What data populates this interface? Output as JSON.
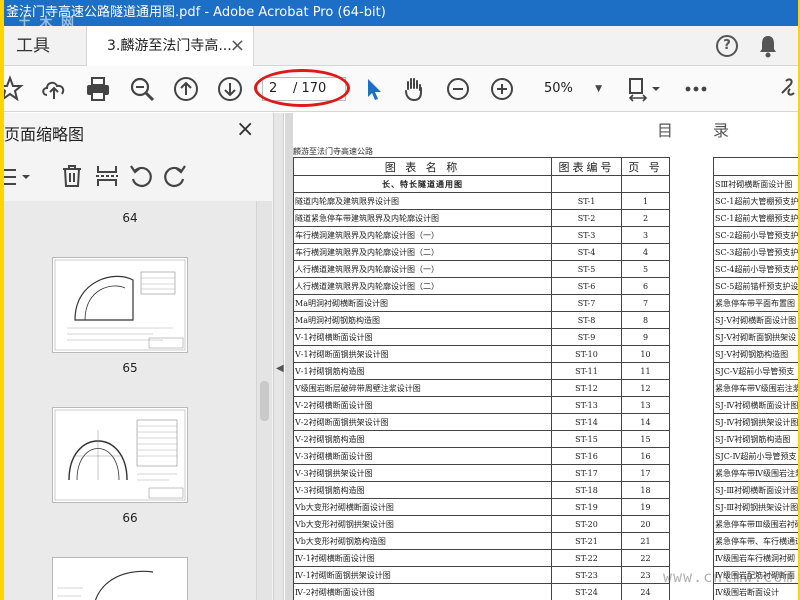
{
  "window": {
    "title": "釜法门寺高速公路隧道通用图.pdf - Adobe Acrobat Pro (64-bit)",
    "watermark": "土 木 网"
  },
  "tabs": {
    "tools_label": "工具",
    "doc_label": "3.麟游至法门寺高...",
    "close_glyph": "×"
  },
  "header_icons": {
    "help": "help-icon",
    "help_glyph": "?",
    "notifications": "bell-icon"
  },
  "toolbar": {
    "icons": [
      "bookmark-star-icon",
      "cloud-upload-icon",
      "print-icon",
      "zoom-search-icon",
      "page-up-icon",
      "page-down-icon",
      "select-cursor-icon",
      "hand-tool-icon",
      "zoom-out-icon",
      "zoom-in-icon",
      "fit-page-icon",
      "more-icon",
      "link-icon"
    ],
    "page_current": "2",
    "page_total": "/ 170",
    "zoom": "50%",
    "highlight_color": "#e01818"
  },
  "sidebar": {
    "title": "页面缩略图",
    "close_glyph": "×",
    "tools": [
      "options-menu-icon",
      "delete-icon",
      "insert-page-icon",
      "undo-icon",
      "redo-icon"
    ],
    "pages": [
      "64",
      "65",
      "66"
    ]
  },
  "document": {
    "heading": "目",
    "heading2": "录",
    "subtitle": "麟游至法门寺高速公路",
    "columns": {
      "name": "图 表 名 称",
      "code": "图表编号",
      "page": "页 号"
    },
    "section": "长、特长隧道通用图",
    "rows": [
      {
        "name": "隧道内轮廓及建筑限界设计图",
        "code": "ST-1",
        "page": "1"
      },
      {
        "name": "隧道紧急停车带建筑限界及内轮廓设计图",
        "code": "ST-2",
        "page": "2"
      },
      {
        "name": "车行横洞建筑限界及内轮廓设计图（一）",
        "code": "ST-3",
        "page": "3"
      },
      {
        "name": "车行横洞建筑限界及内轮廓设计图（二）",
        "code": "ST-4",
        "page": "4"
      },
      {
        "name": "人行横道建筑限界及内轮廓设计图（一）",
        "code": "ST-5",
        "page": "5"
      },
      {
        "name": "人行横道建筑限界及内轮廓设计图（二）",
        "code": "ST-6",
        "page": "6"
      },
      {
        "name": "Ma明洞衬砌横断面设计图",
        "code": "ST-7",
        "page": "7"
      },
      {
        "name": "Ma明洞衬砌钢筋构造图",
        "code": "ST-8",
        "page": "8"
      },
      {
        "name": "Ⅴ-1衬砌横断面设计图",
        "code": "ST-9",
        "page": "9"
      },
      {
        "name": "Ⅴ-1衬砌断面钢拱架设计图",
        "code": "ST-10",
        "page": "10"
      },
      {
        "name": "Ⅴ-1衬砌钢筋构造图",
        "code": "ST-11",
        "page": "11"
      },
      {
        "name": "Ⅴ级围岩断层破碎带周壁注浆设计图",
        "code": "ST-12",
        "page": "12"
      },
      {
        "name": "Ⅴ-2衬砌横断面设计图",
        "code": "ST-13",
        "page": "13"
      },
      {
        "name": "Ⅴ-2衬砌断面钢拱架设计图",
        "code": "ST-14",
        "page": "14"
      },
      {
        "name": "Ⅴ-2衬砌钢筋构造图",
        "code": "ST-15",
        "page": "15"
      },
      {
        "name": "Ⅴ-3衬砌横断面设计图",
        "code": "ST-16",
        "page": "16"
      },
      {
        "name": "Ⅴ-3衬砌钢拱架设计图",
        "code": "ST-17",
        "page": "17"
      },
      {
        "name": "Ⅴ-3衬砌钢筋构造图",
        "code": "ST-18",
        "page": "18"
      },
      {
        "name": "Ⅴb大变形衬砌横断面设计图",
        "code": "ST-19",
        "page": "19"
      },
      {
        "name": "Ⅴb大变形衬砌钢拱架设计图",
        "code": "ST-20",
        "page": "20"
      },
      {
        "name": "Ⅴb大变形衬砌钢筋构造图",
        "code": "ST-21",
        "page": "21"
      },
      {
        "name": "Ⅳ-1衬砌横断面设计图",
        "code": "ST-22",
        "page": "22"
      },
      {
        "name": "Ⅳ-1衬砌断面钢拱架设计图",
        "code": "ST-23",
        "page": "23"
      },
      {
        "name": "Ⅳ-2衬砌横断面设计图",
        "code": "ST-24",
        "page": "24"
      }
    ],
    "right_rows": [
      "SⅢ衬砌横断面设计图",
      "SC-1超前大管棚预支护",
      "SC-1超前大管棚预支护",
      "SC-2超前小导管预支护",
      "SC-3超前小导管预支护",
      "SC-4超前小导管预支护",
      "SC-5超前锚杆预支护设",
      "紧急停车带平面布置图",
      "SJ-Ⅴ衬砌横断面设计图",
      "SJ-Ⅴ衬砌断面钢拱架设",
      "SJ-Ⅴ衬砌钢筋构造图",
      "SJC-Ⅴ超前小导管预支",
      "紧急停车带Ⅴ级围岩注浆",
      "SJ-Ⅳ衬砌横断面设计图",
      "SJ-Ⅳ衬砌钢拱架设计图",
      "SJ-Ⅳ衬砌钢筋构造图",
      "SJC-Ⅳ超前小导管预支",
      "紧急停车带Ⅳ级围岩注浆",
      "SJ-Ⅲ衬砌横断面设计图",
      "SJ-Ⅲ衬砌钢拱架设计图",
      "紧急停车带Ⅲ级围岩衬砌",
      "紧急停车带、车行横通道",
      "Ⅳ级围岩车行横洞衬砌",
      "Ⅳ级围岩配筋衬砌断面",
      "Ⅳ级围岩断面设计"
    ],
    "watermark": "www.cntmw.com"
  }
}
